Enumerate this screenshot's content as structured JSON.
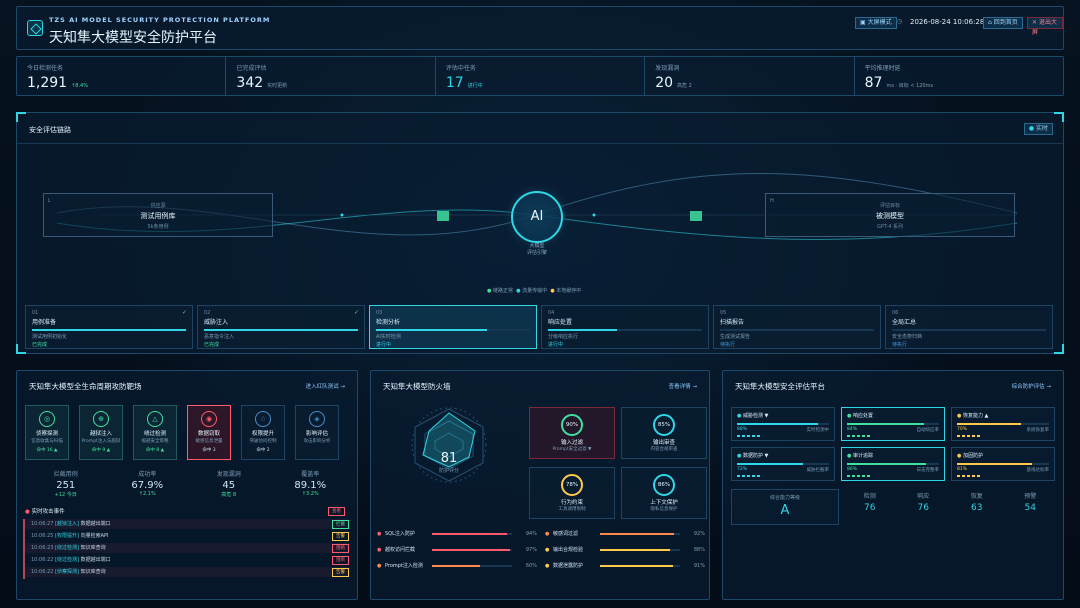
{
  "header": {
    "subtitle": "TZS AI MODEL SECURITY PROTECTION PLATFORM",
    "title": "天知隼大模型安全防护平台",
    "mode": "大屏模式",
    "datetime": "2026-08-24 10:06:28",
    "home_btn": "回到首页",
    "exit_btn": "退出大屏"
  },
  "kpis": [
    {
      "label": "今日检测任务",
      "value": "1,291",
      "sub": "↑8.4%"
    },
    {
      "label": "已完成评估",
      "value": "342",
      "sub": "实时更新"
    },
    {
      "label": "评估中任务",
      "value": "17",
      "sub": "进行中"
    },
    {
      "label": "发现漏洞",
      "value": "20",
      "sub": "高危 2"
    },
    {
      "label": "平均推理时延",
      "value": "87",
      "sub": "ms · 目标 < 120ms"
    }
  ],
  "chain": {
    "title": "安全评估链路",
    "badge": "实时",
    "left": {
      "tag": "L",
      "small": "供应源",
      "name": "测试用例库",
      "desc": "5k条用例"
    },
    "center": {
      "label": "AI",
      "name": "大模型",
      "sub": "评估引擎"
    },
    "right": {
      "tag": "H",
      "small": "评估目标",
      "name": "被测模型",
      "desc": "GPT-4 系列"
    },
    "legend": [
      "链路正常",
      "流量传输中",
      "本地缓存中"
    ],
    "steps": [
      {
        "no": "01",
        "name": "用例准备",
        "desc": "测试用例初始化",
        "status": "已完成",
        "progress": 1.0,
        "done": true
      },
      {
        "no": "02",
        "name": "威胁注入",
        "desc": "恶意指令注入",
        "status": "已完成",
        "progress": 1.0,
        "done": true
      },
      {
        "no": "03",
        "name": "检测分析",
        "desc": "AI实时检测",
        "status": "进行中",
        "progress": 0.72,
        "done": false
      },
      {
        "no": "04",
        "name": "响应处置",
        "desc": "分级响应执行",
        "status": "进行中",
        "progress": 0.45,
        "done": false
      },
      {
        "no": "05",
        "name": "扫描报告",
        "desc": "生成测试报告",
        "status": "待执行",
        "progress": 0.0,
        "done": false
      },
      {
        "no": "06",
        "name": "全局汇总",
        "desc": "安全态势归档",
        "status": "待执行",
        "progress": 0.0,
        "done": false
      }
    ]
  },
  "range": {
    "title": "天知隼大模型全生命周期攻防靶场",
    "link": "进入红队测试 →",
    "stages": [
      {
        "name": "侦察探测",
        "desc": "信息收集与扫描",
        "stat": "命中 16 ▲",
        "icon": "◎"
      },
      {
        "name": "越狱注入",
        "desc": "Prompt注入与越狱",
        "stat": "命中 9 ▲",
        "icon": "⊕"
      },
      {
        "name": "绕过检测",
        "desc": "规避安全策略",
        "stat": "命中 8 ▲",
        "icon": "△"
      },
      {
        "name": "数据窃取",
        "desc": "敏感信息泄露",
        "stat": "命中 3",
        "icon": "◉"
      },
      {
        "name": "权限提升",
        "desc": "突破访问控制",
        "stat": "命中 2",
        "icon": "☆"
      },
      {
        "name": "影响评估",
        "desc": "攻击影响分析",
        "stat": "",
        "icon": "◈"
      }
    ],
    "metrics": [
      {
        "label": "拦截用例",
        "value": "251",
        "sub": "+12 今日"
      },
      {
        "label": "成功率",
        "value": "67.9%",
        "sub": "↑2.1%"
      },
      {
        "label": "发现漏洞",
        "value": "45",
        "sub": "高危 8"
      },
      {
        "label": "覆盖率",
        "value": "89.1%",
        "sub": "↑3.2%"
      }
    ],
    "events_title": "实时攻击事件",
    "events_btn": "查看",
    "events": [
      {
        "time": "10:06:27",
        "type": "[越狱注入]",
        "text": "数据越出端口",
        "tag": "拦截"
      },
      {
        "time": "10:06:25",
        "type": "[权限提升]",
        "text": "向量检索API",
        "tag": "告警"
      },
      {
        "time": "10:06:23",
        "type": "[绕过检测]",
        "text": "知识库查询",
        "tag": "阻断"
      },
      {
        "time": "10:06:22",
        "type": "[绕过检测]",
        "text": "数据越出端口",
        "tag": "阻断"
      },
      {
        "time": "10:06:22",
        "type": "[侦察探测]",
        "text": "知识库查询",
        "tag": "告警"
      }
    ]
  },
  "firewall": {
    "title": "天知隼大模型防火墙",
    "link": "查看详情 →",
    "score": "81",
    "score_label": "防护评分",
    "gauges": [
      {
        "pct": "90%",
        "name": "输入过滤",
        "desc": "Prompt安全过滤 ▼",
        "color": "#3fe0a0"
      },
      {
        "pct": "85%",
        "name": "输出审查",
        "desc": "内容合规审查",
        "color": "#2fd6e6"
      },
      {
        "pct": "78%",
        "name": "行为约束",
        "desc": "工具调用限制",
        "color": "#ffc94a"
      },
      {
        "pct": "86%",
        "name": "上下文保护",
        "desc": "隐私信息保护",
        "color": "#2fd6e6"
      }
    ],
    "bars": [
      {
        "name": "SQL注入防护",
        "pct": "94%",
        "value": 0.94,
        "color": "#ff5b6e"
      },
      {
        "name": "敏感词过滤",
        "pct": "92%",
        "value": 0.92,
        "color": "#ff8a4a"
      },
      {
        "name": "越权访问拦截",
        "pct": "97%",
        "value": 0.97,
        "color": "#ff5b6e"
      },
      {
        "name": "输出合规检验",
        "pct": "88%",
        "value": 0.88,
        "color": "#ffc94a"
      },
      {
        "name": "Prompt注入检测",
        "pct": "60%",
        "value": 0.6,
        "color": "#ff8a4a"
      },
      {
        "name": "数据泄露防护",
        "pct": "91%",
        "value": 0.91,
        "color": "#ffc94a"
      }
    ]
  },
  "evaluation": {
    "title": "天知隼大模型安全评估平台",
    "link": "综合防护评估 →",
    "cards": [
      {
        "name": "威胁检测 ▼",
        "pct": "88%",
        "desc": "实时检测中",
        "value": 0.88,
        "color": "#2fd6e6"
      },
      {
        "name": "响应处置",
        "pct": "84%",
        "desc": "自动响应率",
        "value": 0.84,
        "color": "#3fe0a0"
      },
      {
        "name": "恢复能力 ▲",
        "pct": "70%",
        "desc": "系统恢复率",
        "value": 0.7,
        "color": "#ffc94a"
      },
      {
        "name": "数据防护 ▼",
        "pct": "72%",
        "desc": "威胁拦截率",
        "value": 0.72,
        "color": "#2fd6e6"
      },
      {
        "name": "审计追踪",
        "pct": "86%",
        "desc": "日志完整率",
        "value": 0.86,
        "color": "#3fe0a0"
      },
      {
        "name": "加固防护",
        "pct": "81%",
        "desc": "基线达标率",
        "value": 0.81,
        "color": "#ffc94a"
      }
    ],
    "overall_label": "综合能力等级",
    "grade": "A",
    "scores": [
      {
        "label": "检测",
        "value": "76"
      },
      {
        "label": "响应",
        "value": "76"
      },
      {
        "label": "恢复",
        "value": "63"
      },
      {
        "label": "预警",
        "value": "54"
      }
    ]
  }
}
